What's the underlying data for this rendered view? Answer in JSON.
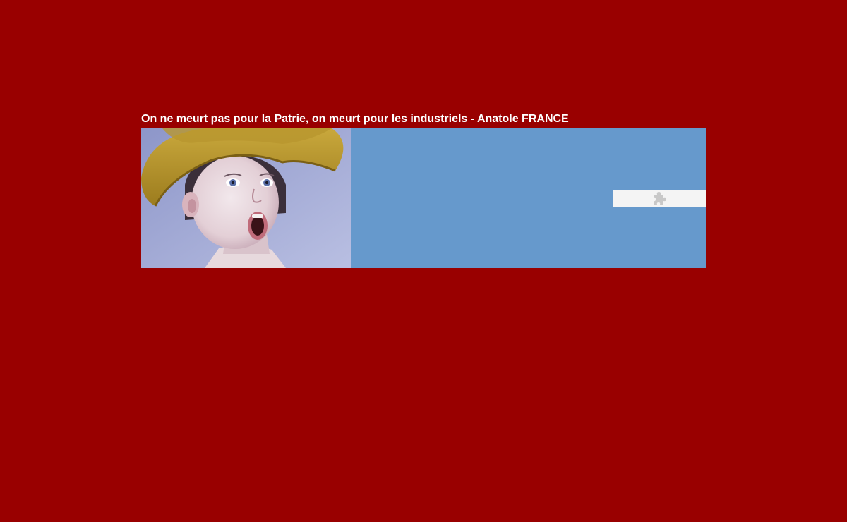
{
  "page": {
    "background_color": "#990000",
    "quote_text": "On ne meurt pas pour la Patrie, on meurt pour les industriels - Anatole FRANCE"
  },
  "banner": {
    "background_color": "#6699cc",
    "photo": {
      "icon": "child-in-hat-photo"
    },
    "plugin_placeholder": {
      "icon": "puzzle-piece-icon",
      "background_color": "#f4f4f4"
    }
  }
}
